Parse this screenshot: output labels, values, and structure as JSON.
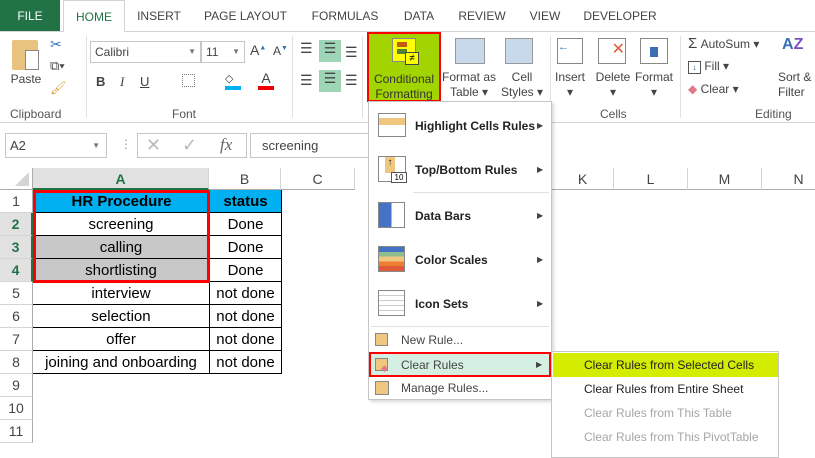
{
  "tabs": [
    "FILE",
    "HOME",
    "INSERT",
    "PAGE LAYOUT",
    "FORMULAS",
    "DATA",
    "REVIEW",
    "VIEW",
    "DEVELOPER"
  ],
  "ribbon": {
    "clipboard": {
      "label": "Clipboard",
      "paste": "Paste"
    },
    "font": {
      "label": "Font",
      "name": "Calibri",
      "size": "11",
      "bold": "B",
      "italic": "I",
      "underline": "U",
      "font_color_letter": "A"
    },
    "styles": {
      "conditional_formatting": [
        "Conditional",
        "Formatting"
      ],
      "format_as_table": [
        "Format as",
        "Table"
      ],
      "cell_styles": [
        "Cell",
        "Styles"
      ]
    },
    "cells": {
      "label": "Cells",
      "insert": "Insert",
      "delete": "Delete",
      "format": "Format"
    },
    "editing": {
      "label": "Editing",
      "autosum": "AutoSum",
      "fill": "Fill",
      "clear": "Clear",
      "sort_filter": [
        "Sort &",
        "Filter"
      ]
    }
  },
  "formula_bar": {
    "name_box": "A2",
    "fx": "fx",
    "value": "screening"
  },
  "columns": [
    "A",
    "B",
    "C",
    "K",
    "L",
    "M",
    "N"
  ],
  "rows": [
    "1",
    "2",
    "3",
    "4",
    "5",
    "6",
    "7",
    "8",
    "9",
    "10",
    "11"
  ],
  "table": {
    "headers": [
      "HR Procedure",
      "status"
    ],
    "rows": [
      [
        "screening",
        "Done"
      ],
      [
        "calling",
        "Done"
      ],
      [
        "shortlisting",
        "Done"
      ],
      [
        "interview",
        "not done"
      ],
      [
        "selection",
        "not done"
      ],
      [
        "offer",
        "not done"
      ],
      [
        "joining and onboarding",
        "not done"
      ]
    ]
  },
  "cf_menu": {
    "items": [
      "Highlight Cells Rules",
      "Top/Bottom Rules",
      "Data Bars",
      "Color Scales",
      "Icon Sets"
    ],
    "new_rule": "New Rule...",
    "clear_rules": "Clear Rules",
    "manage_rules": "Manage Rules..."
  },
  "clear_submenu": [
    "Clear Rules from Selected Cells",
    "Clear Rules from Entire Sheet",
    "Clear Rules from This Table",
    "Clear Rules from This PivotTable"
  ],
  "colors": {
    "excel_green": "#217346",
    "header_fill": "#00b0f0",
    "highlight": "#d4ec00",
    "cf_button": "#a2d400",
    "selection_red": "#ff0000",
    "gray_fill": "#c8c8c8"
  }
}
